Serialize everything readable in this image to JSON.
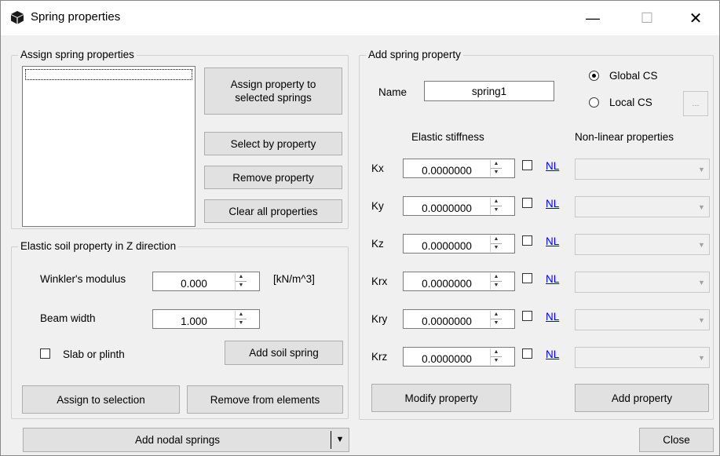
{
  "window": {
    "title": "Spring properties",
    "icon": "cube-icon",
    "minimize": "—",
    "maximize": "☐",
    "close": "✕"
  },
  "assign_group": {
    "title": "Assign spring properties",
    "assign_button": "Assign property to selected springs",
    "select_by_property": "Select by property",
    "remove_property": "Remove property",
    "clear_all": "Clear all properties"
  },
  "soil_group": {
    "title": "Elastic soil property in Z direction",
    "winkler_label": "Winkler's modulus",
    "winkler_value": "0.000",
    "winkler_unit": "[kN/m^3]",
    "beam_width_label": "Beam width",
    "beam_width_value": "1.000",
    "slab_label": "Slab or plinth",
    "add_soil_spring": "Add soil spring",
    "assign_to_selection": "Assign to selection",
    "remove_from_elements": "Remove from elements"
  },
  "add_group": {
    "title": "Add spring property",
    "name_label": "Name",
    "name_value": "spring1",
    "global_cs": "Global CS",
    "local_cs": "Local CS",
    "local_cs_button": "...",
    "elastic_header": "Elastic stiffness",
    "nonlinear_header": "Non-linear properties",
    "rows": [
      {
        "label": "Kx",
        "value": "0.0000000",
        "nl": "NL"
      },
      {
        "label": "Ky",
        "value": "0.0000000",
        "nl": "NL"
      },
      {
        "label": "Kz",
        "value": "0.0000000",
        "nl": "NL"
      },
      {
        "label": "Krx",
        "value": "0.0000000",
        "nl": "NL"
      },
      {
        "label": "Kry",
        "value": "0.0000000",
        "nl": "NL"
      },
      {
        "label": "Krz",
        "value": "0.0000000",
        "nl": "NL"
      }
    ],
    "modify_property": "Modify property",
    "add_property": "Add property"
  },
  "footer": {
    "add_nodal_springs": "Add nodal springs",
    "dropdown_arrow": "▼",
    "close": "Close"
  }
}
